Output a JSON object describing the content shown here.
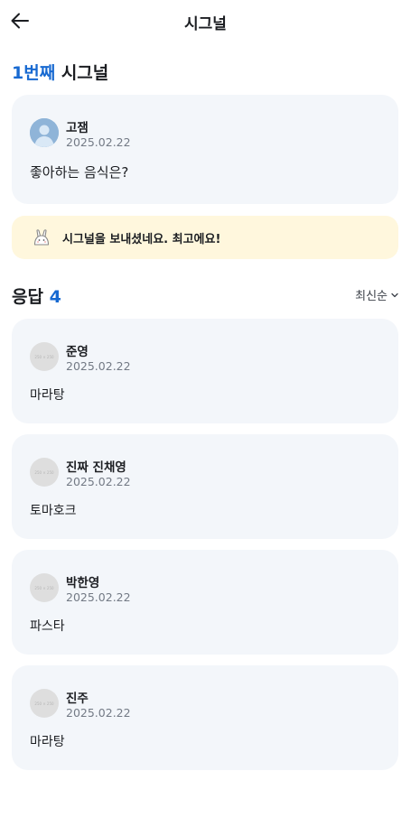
{
  "header": {
    "title": "시그널"
  },
  "signal": {
    "count_number": "1번째",
    "count_suffix": "시그널",
    "author": "고잼",
    "date": "2025.02.22",
    "question": "좋아하는 음식은?"
  },
  "notice": {
    "icon": "rabbit-icon",
    "text": "시그널을 보내셨네요. 최고에요!"
  },
  "answers": {
    "label": "응답",
    "count": "4",
    "sort_label": "최신순",
    "avatar_placeholder": "250 × 250",
    "items": [
      {
        "name": "준영",
        "date": "2025.02.22",
        "text": "마라탕"
      },
      {
        "name": "진짜 진채영",
        "date": "2025.02.22",
        "text": "토마호크"
      },
      {
        "name": "박한영",
        "date": "2025.02.22",
        "text": "파스타"
      },
      {
        "name": "진주",
        "date": "2025.02.22",
        "text": "마라탕"
      }
    ]
  },
  "colors": {
    "accent": "#1769d1",
    "card_bg": "#f3f6fa",
    "notice_bg": "#fff7dd"
  }
}
